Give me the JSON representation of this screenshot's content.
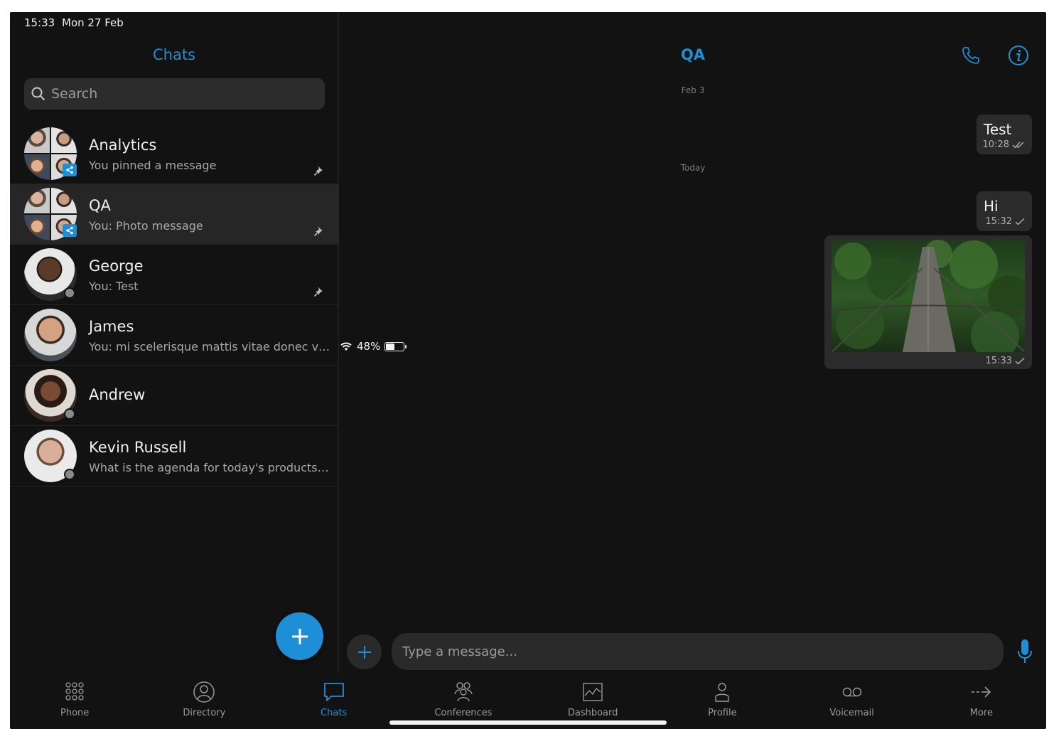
{
  "status_bar": {
    "time": "15:33",
    "date": "Mon 27 Feb",
    "battery": "48%",
    "battery_level": 0.48
  },
  "chats_pane": {
    "title": "Chats",
    "search_placeholder": "Search",
    "chats": [
      {
        "name": "Analytics",
        "preview": "You pinned a message",
        "pinned": true,
        "group": true
      },
      {
        "name": "QA",
        "preview": "You: Photo message",
        "pinned": true,
        "group": true,
        "selected": true
      },
      {
        "name": "George",
        "preview": "You: Test",
        "pinned": true,
        "group": false
      },
      {
        "name": "James",
        "preview": "You: mi scelerisque mattis vitae donec velit...",
        "pinned": false,
        "group": false
      },
      {
        "name": "Andrew",
        "preview": "",
        "pinned": false,
        "group": false
      },
      {
        "name": "Kevin Russell",
        "preview": "What is the agenda for today's products m...",
        "pinned": false,
        "group": false
      }
    ]
  },
  "conversation": {
    "title": "QA",
    "separators": [
      "Feb 3",
      "Today"
    ],
    "messages": [
      {
        "text": "Test",
        "time": "10:28",
        "status": "read"
      },
      {
        "text": "Hi",
        "time": "15:32",
        "status": "sent"
      },
      {
        "type": "photo",
        "time": "15:33",
        "status": "sent"
      }
    ],
    "composer_placeholder": "Type a message..."
  },
  "tabbar": {
    "tabs": [
      {
        "label": "Phone",
        "icon": "dialpad-icon"
      },
      {
        "label": "Directory",
        "icon": "directory-icon"
      },
      {
        "label": "Chats",
        "icon": "chat-bubble-icon",
        "active": true
      },
      {
        "label": "Conferences",
        "icon": "conference-icon"
      },
      {
        "label": "Dashboard",
        "icon": "dashboard-icon"
      },
      {
        "label": "Profile",
        "icon": "profile-icon"
      },
      {
        "label": "Voicemail",
        "icon": "voicemail-icon"
      },
      {
        "label": "More",
        "icon": "more-arrow-icon"
      }
    ]
  },
  "colors": {
    "accent": "#1e8fd6",
    "background": "#121212",
    "bubble": "#2b2b2b"
  }
}
